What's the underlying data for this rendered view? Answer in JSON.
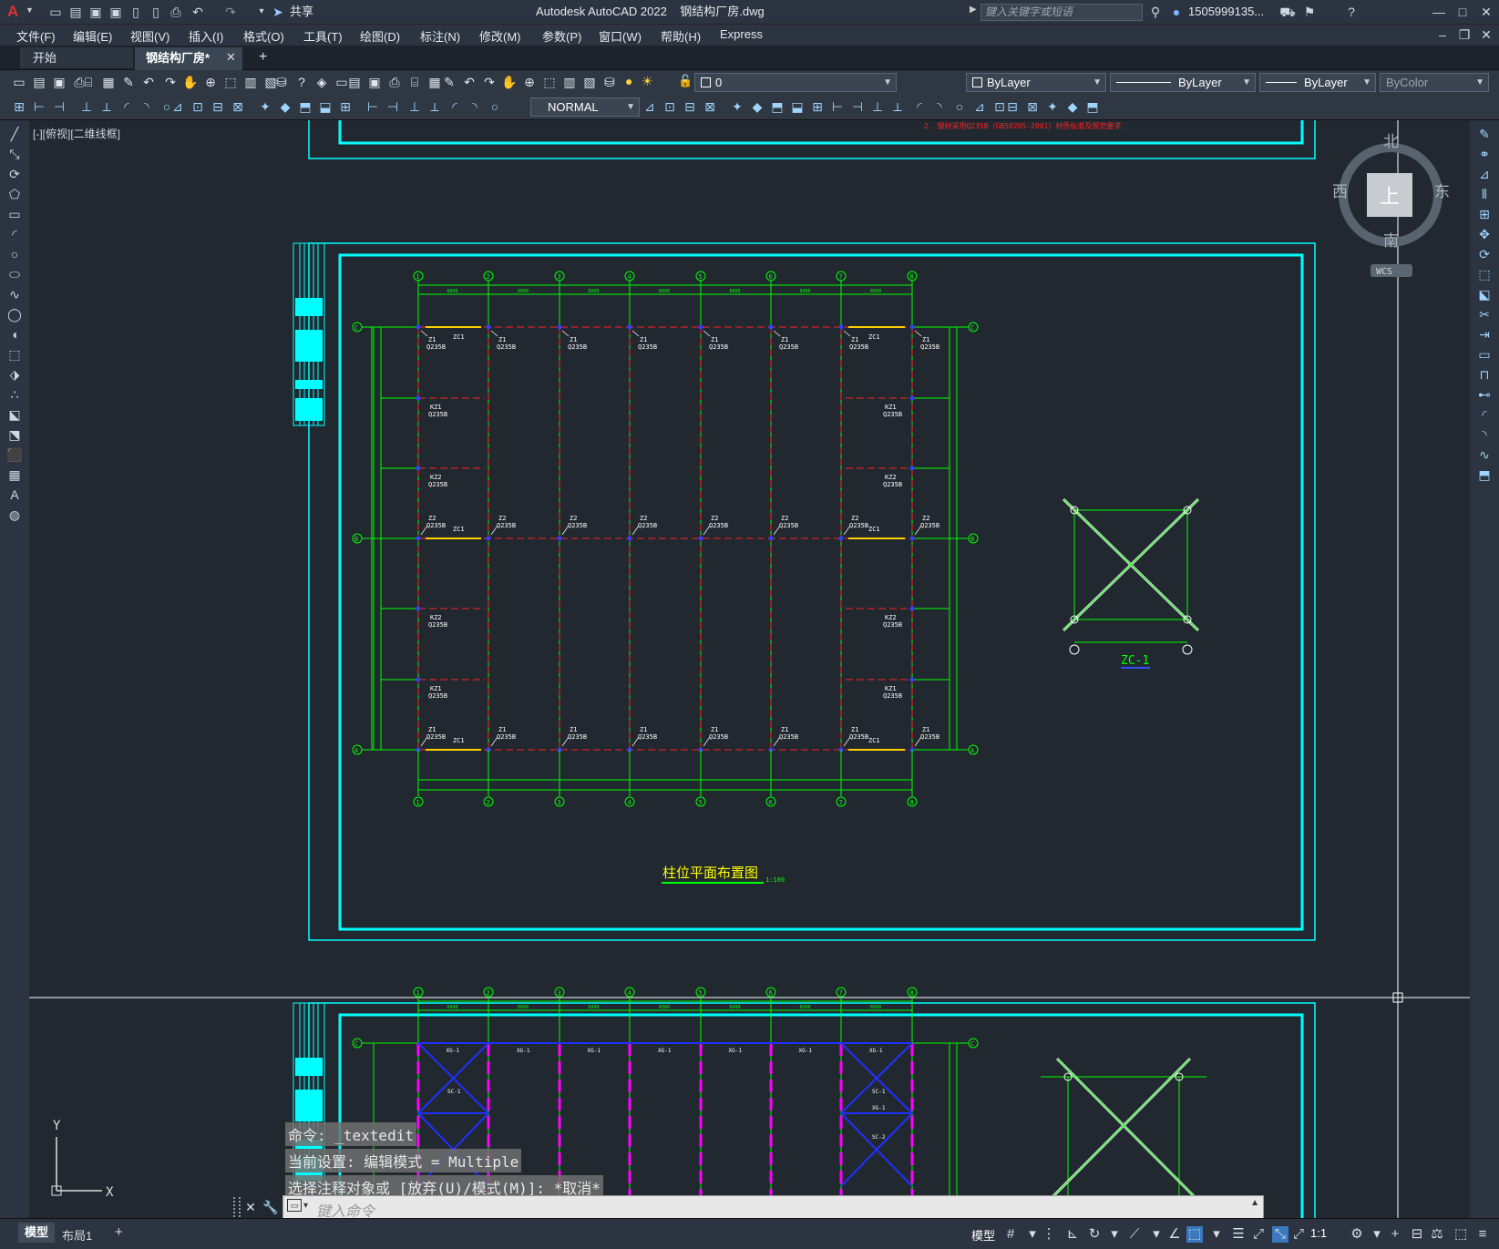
{
  "title": {
    "app": "Autodesk AutoCAD 2022",
    "file": "钢结构厂房.dwg",
    "search_placeholder": "键入关键字或短语",
    "user": "1505999135...",
    "share": "共享"
  },
  "menu": [
    "文件(F)",
    "编辑(E)",
    "视图(V)",
    "插入(I)",
    "格式(O)",
    "工具(T)",
    "绘图(D)",
    "标注(N)",
    "修改(M)",
    "参数(P)",
    "窗口(W)",
    "帮助(H)",
    "Express"
  ],
  "tabs": {
    "start": "开始",
    "active": "钢结构厂房*",
    "add": "+"
  },
  "toolbar": {
    "layer": "0",
    "color": "ByLayer",
    "linetype": "ByLayer",
    "lineweight": "ByLayer",
    "plotstyle": "ByColor",
    "dimstyle": "NORMAL"
  },
  "viewport": {
    "label": "[-][俯视][二维线框]"
  },
  "viewcube": {
    "north": "北",
    "south": "南",
    "east": "东",
    "west": "西",
    "top": "上",
    "wcs": "WCS"
  },
  "drawing": {
    "title1": "柱位平面布置图",
    "scale1": "1:100",
    "note": "2. 钢材采用Q235B（GB50205-2001）材质标准及规范要求",
    "detail": "ZC-1",
    "grid_cols": [
      "1",
      "2",
      "3",
      "4",
      "5",
      "6",
      "7",
      "8"
    ],
    "grid_rows": [
      "C",
      "B",
      "A"
    ],
    "col_labels": [
      "Z1",
      "Z2",
      "KZ1",
      "KZ2",
      "ZC1"
    ],
    "mat": "Q235B",
    "lower_labels": [
      "XG-1",
      "SC-1",
      "SC-2"
    ],
    "ucs_x": "X",
    "ucs_y": "Y"
  },
  "command": {
    "history": [
      "命令: _textedit",
      "当前设置: 编辑模式 = Multiple",
      "选择注释对象或 [放弃(U)/模式(M)]: *取消*"
    ],
    "placeholder": "键入命令"
  },
  "status": {
    "model_tab": "模型",
    "layout_tab": "布局1",
    "add": "+",
    "mode": "模型",
    "scale": "1:1"
  },
  "colors": {
    "accent": "#00ffff",
    "grid_green": "#00ff00",
    "axis_red": "#ff0000",
    "brace_blue": "#0000ff",
    "column_magenta": "#ff00ff"
  }
}
